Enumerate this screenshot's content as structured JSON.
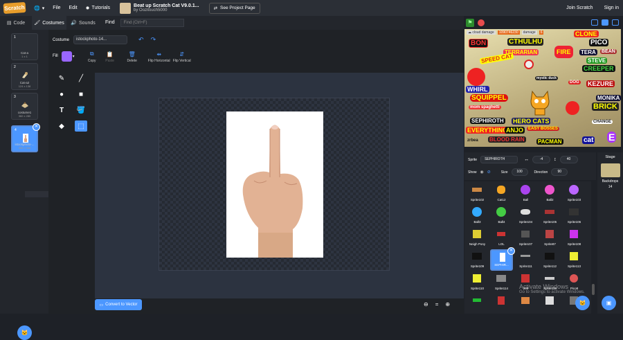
{
  "menubar": {
    "logo": "Scratch",
    "file": "File",
    "edit": "Edit",
    "tutorials": "Tutorials",
    "project_title": "Beat up Scratch Cat V9.0.1...",
    "project_author": "by Oozitouch5000",
    "see_project": "See Project Page",
    "join": "Join Scratch",
    "signin": "Sign in"
  },
  "tabs": {
    "code": "Code",
    "costumes": "Costumes",
    "sounds": "Sounds",
    "find_label": "Find",
    "find_placeholder": "Find (Ctrl+F)"
  },
  "costumes": [
    {
      "num": "1",
      "name": "Cat-a",
      "size": "1 x 1"
    },
    {
      "num": "2",
      "name": "Cat-a2",
      "size": "124 x 138"
    },
    {
      "num": "3",
      "name": "costume1",
      "size": "360 x 280"
    },
    {
      "num": "4",
      "name": "istockphoto-...",
      "size": "356 x 368"
    }
  ],
  "editor": {
    "costume_label": "Costume",
    "costume_name": "istockphoto-14...",
    "fill_label": "Fill",
    "fill_color": "#9966ff",
    "copy": "Copy",
    "paste": "Paste",
    "delete": "Delete",
    "flip_h": "Flip Horizontal",
    "flip_v": "Flip Vertical",
    "convert": "Convert to Vector"
  },
  "stage": {
    "hud_cloud": "☁ cloud damage",
    "hud_cloud_val": "1090746230",
    "hud_damage": "damage",
    "hud_damage_val": "6",
    "logos": [
      "BON",
      "CTHULHU",
      "TERRARIAN",
      "FIRE",
      "PICO",
      "CLONE",
      "TERA",
      "BEAN",
      "STEVE",
      "CREEPER",
      "KEZURE",
      "SPEED CAT",
      "WHIRL",
      "SQUIPPEL",
      "mom spaghetti",
      "SEPHIROTH",
      "HERO CATS",
      "EVERYTHING",
      "ANJO",
      "EASY BOSSES",
      "BLOOD RAIN",
      "PACMAN",
      "MONIKA",
      "BRICK",
      "cat",
      "E",
      "mystic duck",
      "CHANGE",
      "zrbea",
      "DOG"
    ]
  },
  "sprite_info": {
    "sprite_label": "Sprite",
    "sprite_name": "SEPHIROTH",
    "x": "-4",
    "y": "40",
    "show_label": "Show",
    "size_label": "Size",
    "size": "100",
    "direction_label": "Direction",
    "direction": "90"
  },
  "stage_side": {
    "title": "Stage",
    "backdrops_label": "Backdrops",
    "backdrops_count": "14"
  },
  "sprites": [
    "Sprite102",
    "Cat12",
    "Ball",
    "Ball2",
    "Sprite103",
    "Ball3",
    "Ball4",
    "Sprite104",
    "Sprite105",
    "Sprite106",
    "Neigh Pony",
    "LOL",
    "Sprite107",
    "Sprite87",
    "Sprite108",
    "Sprite109",
    "SEPHIR...",
    "Sprite111",
    "Sprite112",
    "Sprite113",
    "Sprite110",
    "Sprite114",
    "200",
    "Sprite115",
    "Pico8",
    "",
    "",
    "",
    "",
    ""
  ],
  "watermark": {
    "title": "Activate Windows",
    "sub": "Go to Settings to activate Windows."
  }
}
